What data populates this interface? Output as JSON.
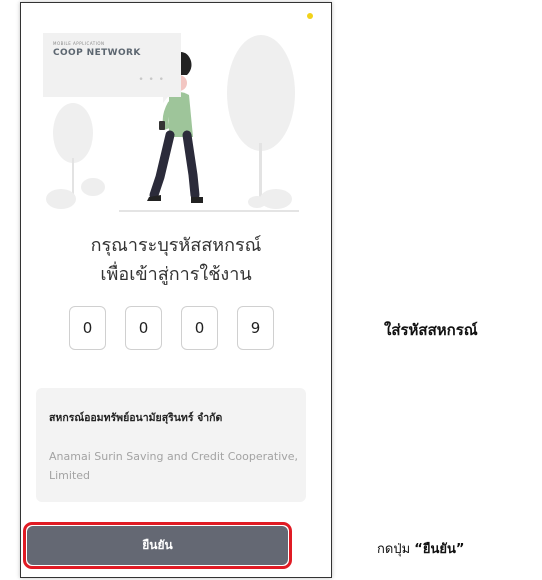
{
  "bubble": {
    "subtitle": "MOBILE APPLICATION",
    "title": "COOP NETWORK",
    "dots": "• • •"
  },
  "page": {
    "title_line1": "กรุณาระบุรหัสสหกรณ์",
    "title_line2": "เพื่อเข้าสู่การใช้งาน"
  },
  "pin": [
    "0",
    "0",
    "0",
    "9"
  ],
  "coop": {
    "name_th": "สหกรณ์ออมทรัพย์อนามัยสุรินทร์ จำกัด",
    "name_en": "Anamai Surin Saving and Credit Cooperative, Limited"
  },
  "confirm": {
    "label": "ยืนยัน"
  },
  "annotations": {
    "enter_code": "ใส่รหัสสหกรณ์",
    "press_prefix": "กดปุ่ม ",
    "press_button": "“ยืนยัน”"
  },
  "colors": {
    "accent_red": "#e01b24",
    "button_gray": "#646873",
    "status_yellow": "#f2d21a"
  }
}
